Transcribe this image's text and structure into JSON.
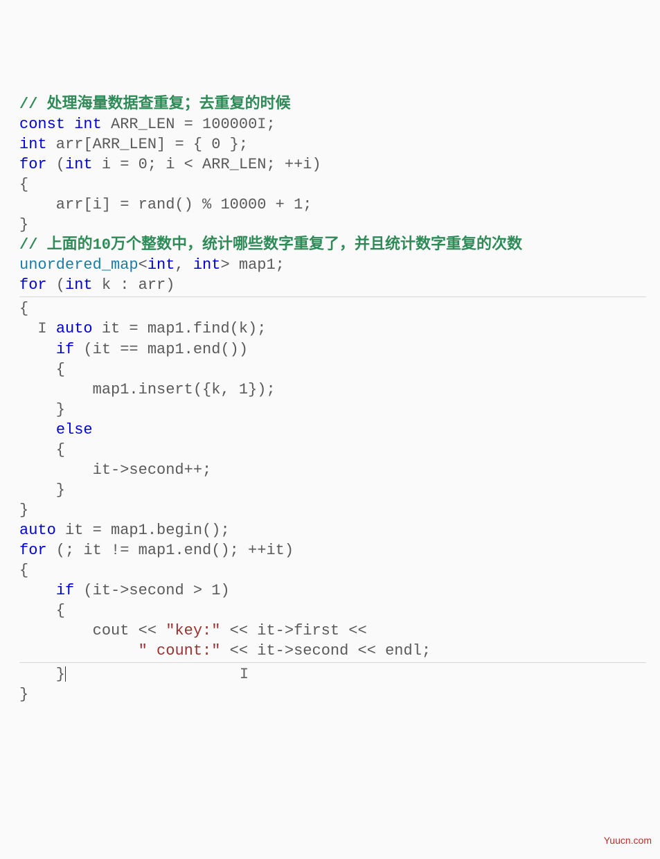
{
  "code": {
    "c1": "// 处理海量数据查重复；去重复的时候",
    "l2a": "const",
    "l2b": "int",
    "l2c": " ARR_LEN = 100000",
    "l2d": ";",
    "l3a": "int",
    "l3b": " arr[ARR_LEN] = { 0 };",
    "l4a": "for",
    "l4b": " (",
    "l4c": "int",
    "l4d": " i = 0; i < ARR_LEN; ++i)",
    "l5": "{",
    "l6": "    arr[i] = rand() % 10000 + 1;",
    "l7": "}",
    "c2": "// 上面的10万个整数中，统计哪些数字重复了，并且统计数字重复的次数",
    "l9a": "unordered_map",
    "l9b": "<",
    "l9c": "int",
    "l9d": ", ",
    "l9e": "int",
    "l9f": "> map1;",
    "l10a": "for",
    "l10b": " (",
    "l10c": "int",
    "l10d": " k : arr)",
    "l11": "{",
    "l12a": "  ",
    "l12b": "auto",
    "l12c": " it = map1.find(k);",
    "l13a": "    ",
    "l13b": "if",
    "l13c": " (it == map1.end())",
    "l14": "    {",
    "l15": "        map1.insert({k, 1});",
    "l16": "    }",
    "l17a": "    ",
    "l17b": "else",
    "l18": "    {",
    "l19": "        it->second++;",
    "l20": "    }",
    "l21": "}",
    "l22a": "auto",
    "l22b": " it = map1.begin();",
    "l23a": "for",
    "l23b": " (; it != map1.end(); ++it)",
    "l24": "{",
    "l25a": "    ",
    "l25b": "if",
    "l25c": " (it->second > 1)",
    "l26": "    {",
    "l27a": "        cout << ",
    "l27b": "\"key:\"",
    "l27c": " << it->first <<",
    "l28a": "             ",
    "l28b": "\" count:\"",
    "l28c": " << it->second << endl;",
    "l29": "    }",
    "l30": "}",
    "caret1": "I",
    "caret2": "I",
    "caret3": "I"
  },
  "watermark": "Yuucn.com"
}
